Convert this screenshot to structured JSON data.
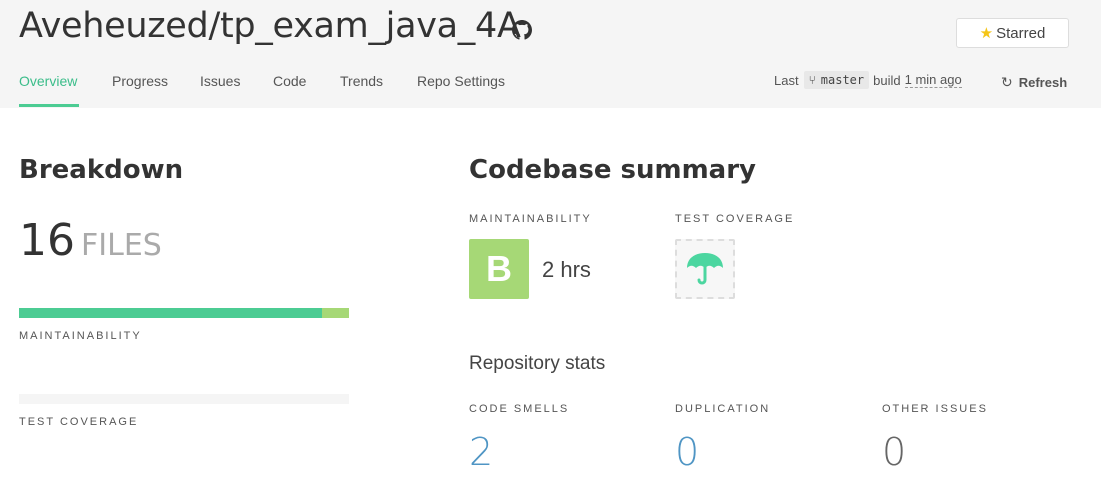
{
  "header": {
    "repo_title": "Aveheuzed/tp_exam_java_4A",
    "star_label": "Starred",
    "nav": [
      "Overview",
      "Progress",
      "Issues",
      "Code",
      "Trends",
      "Repo Settings"
    ],
    "build": {
      "prefix": "Last",
      "branch": "master",
      "middle": "build",
      "time": "1 min ago"
    },
    "refresh_label": "Refresh"
  },
  "breakdown": {
    "title": "Breakdown",
    "files_count": "16",
    "files_label": "FILES",
    "maintainability_label": "MAINTAINABILITY",
    "maintainability_bar": [
      {
        "fraction": 0.918,
        "color": "#4ccc93"
      },
      {
        "fraction": 0.082,
        "color": "#a6d876"
      }
    ],
    "test_coverage_label": "TEST COVERAGE"
  },
  "summary": {
    "title": "Codebase summary",
    "maintainability_label": "MAINTAINABILITY",
    "grade": "B",
    "grade_color": "#a6d876",
    "debt": "2 hrs",
    "test_coverage_label": "TEST COVERAGE",
    "coverage_icon": "umbrella-icon",
    "stats_title": "Repository stats",
    "stats": [
      {
        "label": "CODE SMELLS",
        "value": "2"
      },
      {
        "label": "DUPLICATION",
        "value": "0"
      },
      {
        "label": "OTHER ISSUES",
        "value": "0"
      }
    ]
  }
}
